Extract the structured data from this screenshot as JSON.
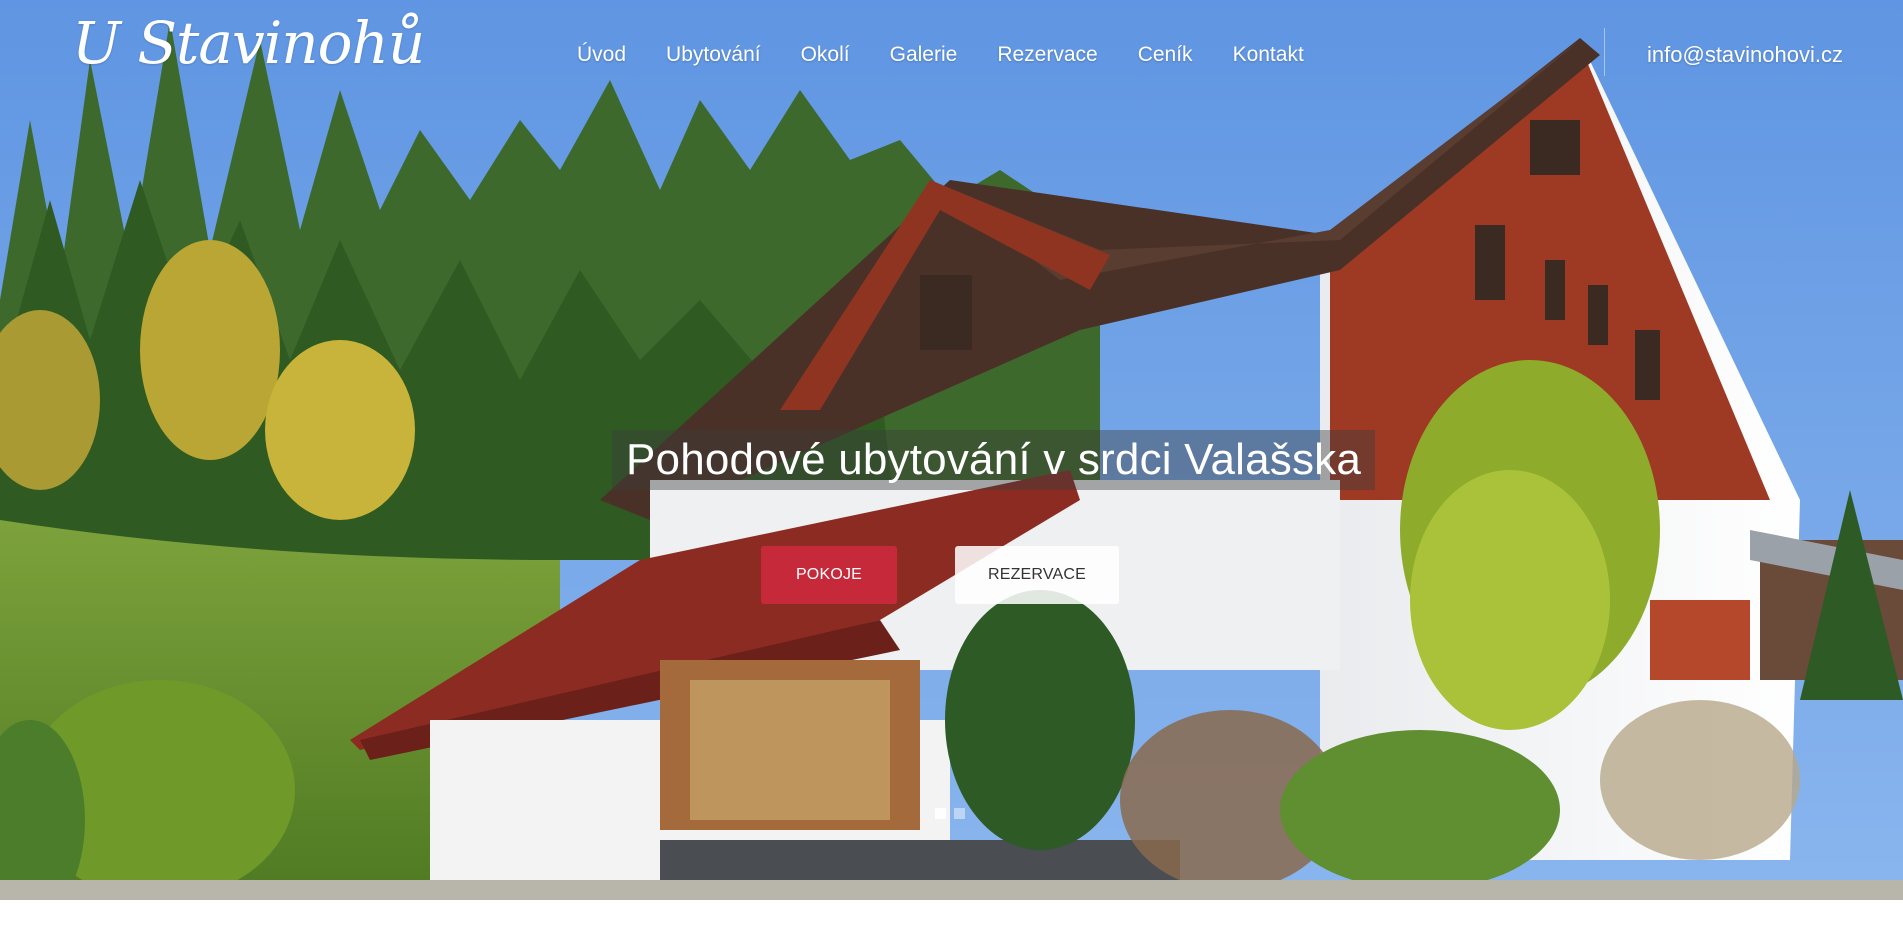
{
  "header": {
    "logo_text": "U Stavinohů",
    "nav": [
      "Úvod",
      "Ubytování",
      "Okolí",
      "Galerie",
      "Rezervace",
      "Ceník",
      "Kontakt"
    ],
    "email": "info@stavinohovi.cz"
  },
  "hero": {
    "headline": "Pohodové ubytování v srdci Valašska",
    "primary_button": "POKOJE",
    "secondary_button": "REZERVACE",
    "slides": 2,
    "active_slide": 1
  },
  "colors": {
    "accent": "#c62a3a",
    "sky": "#6fa3e6",
    "nav_text": "#ffffff"
  },
  "icons": [
    "slider-dot"
  ]
}
